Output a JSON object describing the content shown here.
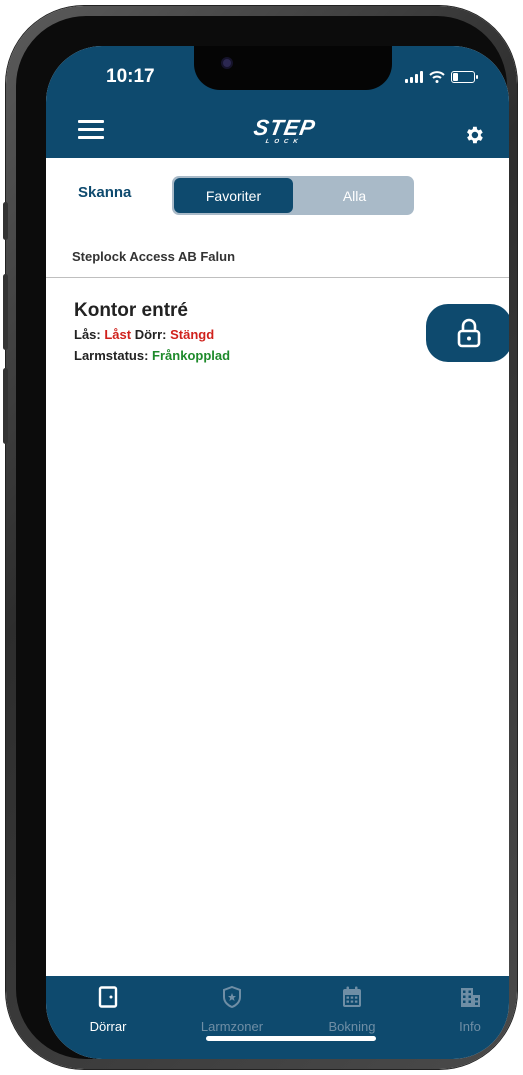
{
  "status_bar": {
    "time": "10:17"
  },
  "header": {
    "logo_main": "STEP",
    "logo_sub": "LOCK",
    "menu_icon": "hamburger-icon",
    "settings_icon": "gear-icon"
  },
  "filter": {
    "scan_label": "Skanna",
    "segments": [
      {
        "label": "Favoriter",
        "active": true
      },
      {
        "label": "Alla",
        "active": false
      }
    ]
  },
  "site": {
    "name": "Steplock Access AB Falun"
  },
  "doors": [
    {
      "name": "Kontor entré",
      "lock_label": "Lås:",
      "lock_value": "Låst",
      "door_label": "Dörr:",
      "door_value": "Stängd",
      "alarm_label": "Larmstatus:",
      "alarm_value": "Frånkopplad",
      "action_icon": "padlock-icon"
    }
  ],
  "tabs": [
    {
      "label": "Dörrar",
      "icon": "door-icon",
      "active": true
    },
    {
      "label": "Larmzoner",
      "icon": "shield-icon",
      "active": false
    },
    {
      "label": "Bokning",
      "icon": "calendar-icon",
      "active": false
    },
    {
      "label": "Info",
      "icon": "building-icon",
      "active": false
    }
  ],
  "colors": {
    "primary": "#0e4a6e",
    "segment_inactive": "#a9bac8",
    "status_red": "#d0211c",
    "status_green": "#1e8a2b",
    "tab_inactive": "#6f8ea5"
  }
}
